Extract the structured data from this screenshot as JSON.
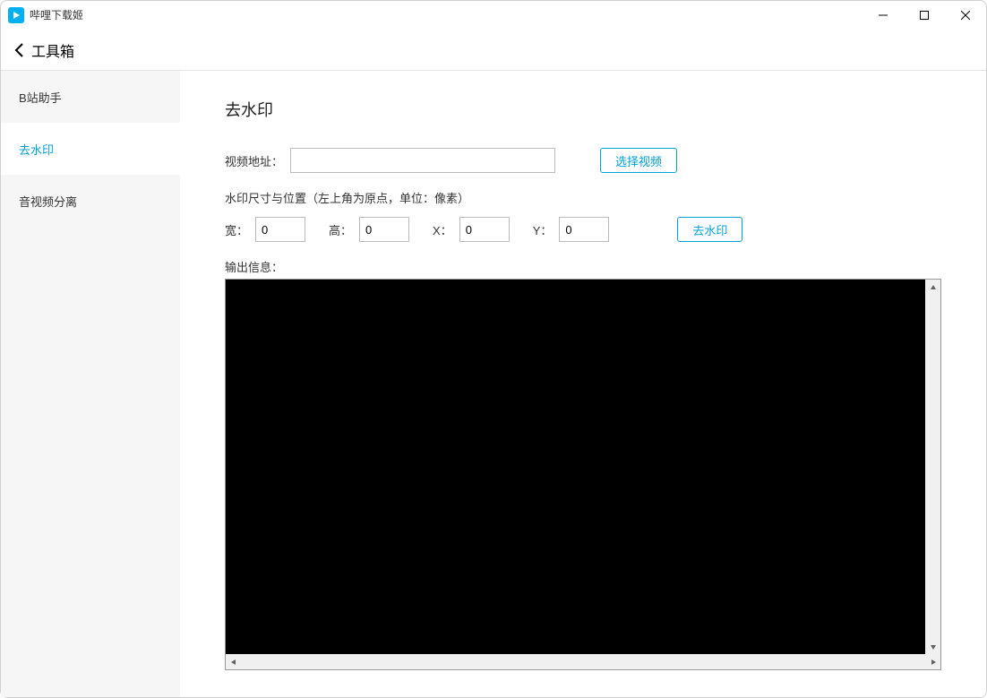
{
  "window": {
    "title": "哔哩下载姬"
  },
  "header": {
    "title": "工具箱"
  },
  "sidebar": {
    "items": [
      {
        "label": "B站助手"
      },
      {
        "label": "去水印"
      },
      {
        "label": "音视频分离"
      }
    ],
    "activeIndex": 1
  },
  "main": {
    "title": "去水印",
    "videoUrlLabel": "视频地址：",
    "videoUrlValue": "",
    "selectVideoBtn": "选择视频",
    "dimSectionLabel": "水印尺寸与位置（左上角为原点，单位：像素）",
    "widthLabel": "宽：",
    "widthValue": "0",
    "heightLabel": "高：",
    "heightValue": "0",
    "xLabel": "X：",
    "xValue": "0",
    "yLabel": "Y：",
    "yValue": "0",
    "removeWatermarkBtn": "去水印",
    "outputLabel": "输出信息："
  }
}
